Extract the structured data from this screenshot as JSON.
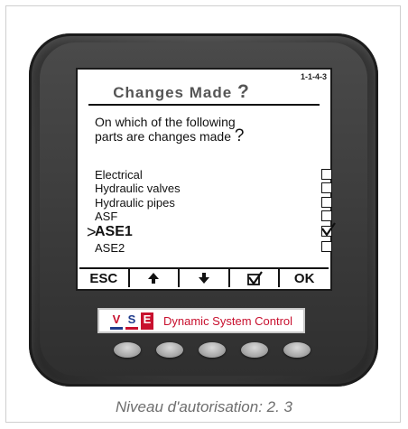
{
  "screen": {
    "title": "Changes Made",
    "title_mark": "?",
    "code": "1-1-4-3",
    "question_line1": "On which of the following",
    "question_line2": "parts are changes made",
    "question_mark": "?",
    "cursor": ">",
    "options": [
      {
        "label": "Electrical",
        "checked": false,
        "selected": false
      },
      {
        "label": "Hydraulic valves",
        "checked": false,
        "selected": false
      },
      {
        "label": "Hydraulic pipes",
        "checked": false,
        "selected": false
      },
      {
        "label": "ASF",
        "checked": false,
        "selected": false
      },
      {
        "label": "ASE1",
        "checked": true,
        "selected": true
      },
      {
        "label": "ASE2",
        "checked": false,
        "selected": false
      }
    ],
    "softkeys": {
      "esc": "ESC",
      "up": "up-arrow-icon",
      "down": "down-arrow-icon",
      "check": "checkmark-icon",
      "ok": "OK"
    }
  },
  "logo": {
    "letters": [
      "V",
      "S",
      "E"
    ],
    "text": "Dynamic System Control"
  },
  "caption": "Niveau d'autorisation: 2. 3",
  "colors": {
    "brand_red": "#c8102e",
    "brand_blue": "#1f3b8c",
    "device_body": "#3a3a3a"
  }
}
